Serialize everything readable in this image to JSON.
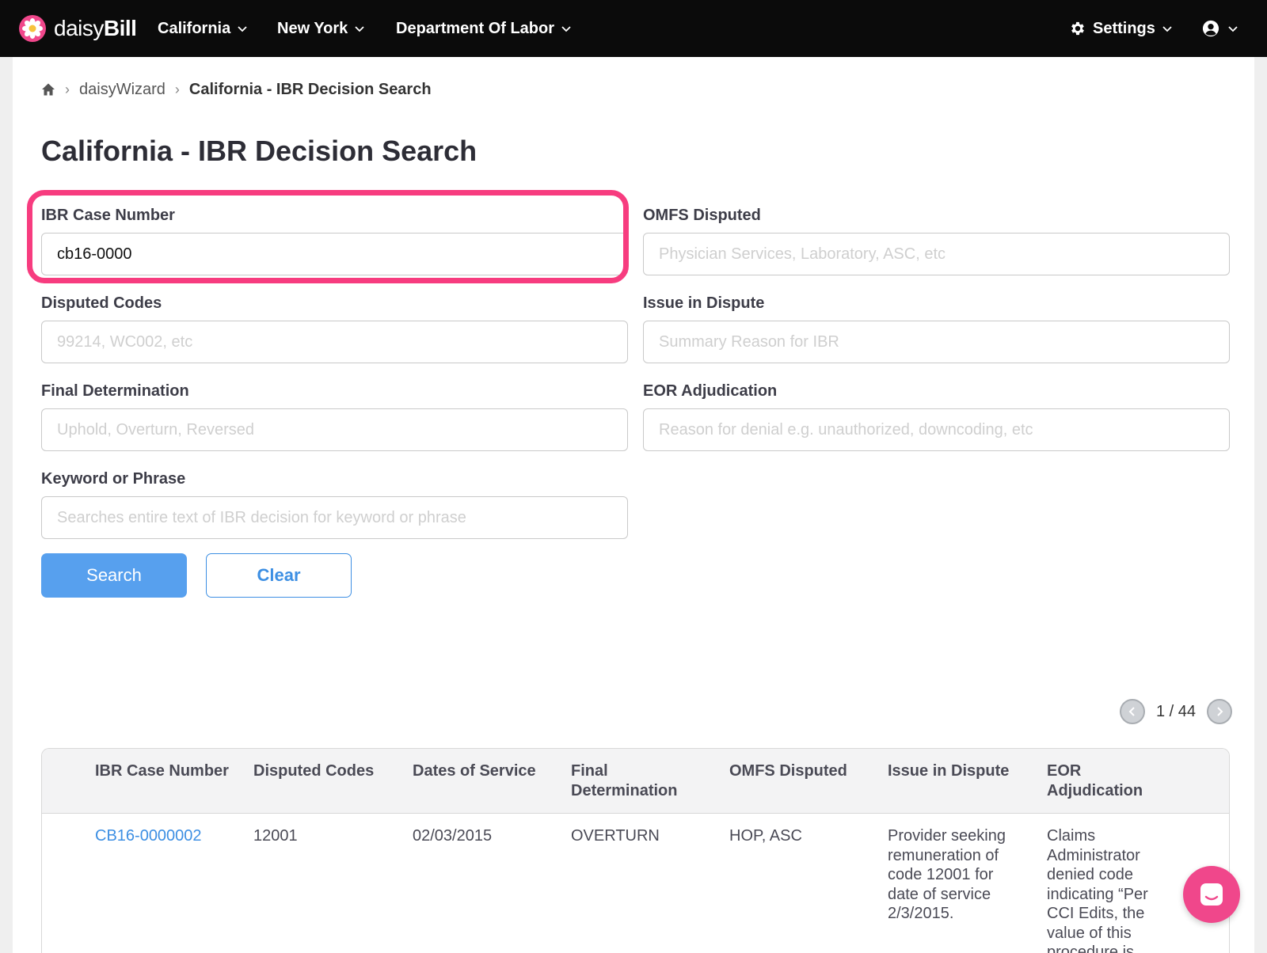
{
  "nav": {
    "logo_prefix": "daisy",
    "logo_suffix": "Bill",
    "items": [
      {
        "label": "California"
      },
      {
        "label": "New York"
      },
      {
        "label": "Department Of Labor"
      }
    ],
    "settings_label": "Settings"
  },
  "breadcrumb": {
    "items": [
      "daisyWizard",
      "California - IBR Decision Search"
    ]
  },
  "page": {
    "title": "California - IBR Decision Search"
  },
  "form": {
    "ibr_case_number": {
      "label": "IBR Case Number",
      "value": "cb16-0000",
      "placeholder": ""
    },
    "omfs_disputed": {
      "label": "OMFS Disputed",
      "value": "",
      "placeholder": "Physician Services, Laboratory, ASC, etc"
    },
    "disputed_codes": {
      "label": "Disputed Codes",
      "value": "",
      "placeholder": "99214, WC002, etc"
    },
    "issue_in_dispute": {
      "label": "Issue in Dispute",
      "value": "",
      "placeholder": "Summary Reason for IBR"
    },
    "final_determination": {
      "label": "Final Determination",
      "value": "",
      "placeholder": "Uphold, Overturn, Reversed"
    },
    "eor_adjudication": {
      "label": "EOR Adjudication",
      "value": "",
      "placeholder": "Reason for denial e.g. unauthorized, downcoding, etc"
    },
    "keyword": {
      "label": "Keyword or Phrase",
      "value": "",
      "placeholder": "Searches entire text of IBR decision for keyword or phrase"
    },
    "search_label": "Search",
    "clear_label": "Clear"
  },
  "pagination": {
    "text": "1 / 44"
  },
  "table": {
    "columns": [
      "IBR Case Number",
      "Disputed Codes",
      "Dates of Service",
      "Final Determination",
      "OMFS Disputed",
      "Issue in Dispute",
      "EOR Adjudication"
    ],
    "rows": [
      {
        "case_number": "CB16-0000002",
        "disputed_codes": "12001",
        "dates_of_service": "02/03/2015",
        "final_determination": "OVERTURN",
        "omfs_disputed": "HOP, ASC",
        "issue_in_dispute": "Provider seeking remuneration of code 12001 for date of service 2/3/2015.",
        "eor_adjudication": "Claims Administrator denied code indicating “Per CCI Edits, the value of this procedure is"
      }
    ]
  },
  "colors": {
    "nav_bg": "#0b0b0b",
    "accent_blue": "#3d8fe3",
    "search_button": "#57a0ee",
    "highlight_pink": "#f73c7f",
    "chat_pink": "#f0478b"
  },
  "icons": {
    "logo": "daisy-flower-icon",
    "home": "home-icon",
    "settings": "gear-icon",
    "account": "user-circle-icon",
    "pager_prev": "chevron-left-icon",
    "pager_next": "chevron-right-icon",
    "chat": "chat-icon"
  }
}
